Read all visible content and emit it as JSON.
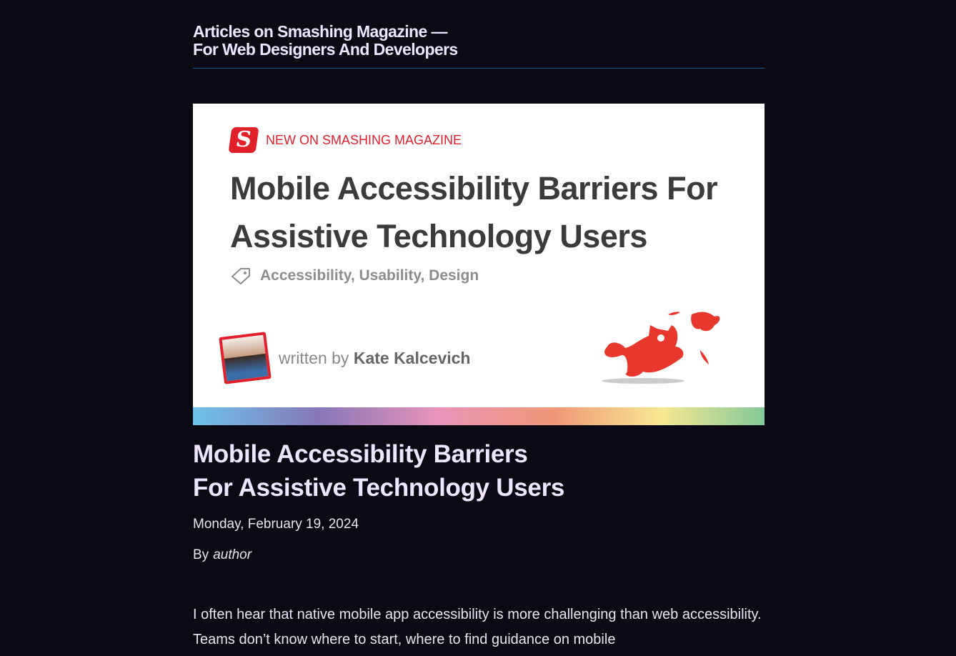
{
  "site": {
    "title_line1": "Articles on Smashing Magazine —",
    "title_line2": "For Web Designers And Developers"
  },
  "hero": {
    "logo_letter": "S",
    "kicker": "NEW ON SMASHING MAGAZINE",
    "title": "Mobile Accessibility Barriers For Assistive Technology Users",
    "tags": "Accessibility, Usability, Design",
    "written_by": "written by",
    "author_name": "Kate Kalcevich"
  },
  "article": {
    "title_line1": "Mobile Accessibility Barriers",
    "title_line2": "For Assistive Technology Users",
    "date": "Monday, February 19, 2024",
    "by_label": "By",
    "author": "author",
    "body": "I often hear that native mobile app accessibility is more challenging than web accessibility. Teams don’t know where to start, where to find guidance on mobile"
  }
}
